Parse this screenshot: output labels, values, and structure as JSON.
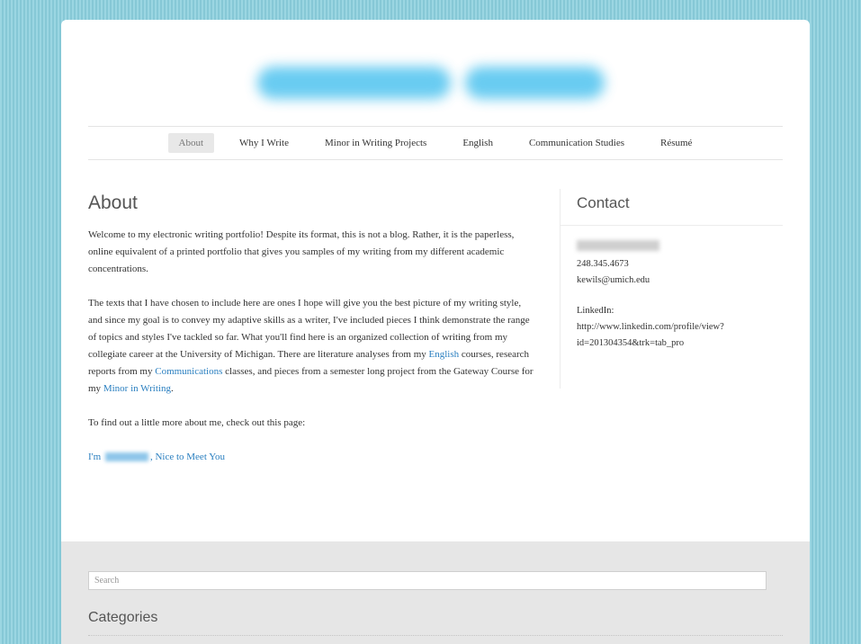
{
  "nav": {
    "items": [
      {
        "label": "About",
        "active": true
      },
      {
        "label": "Why I Write"
      },
      {
        "label": "Minor in Writing Projects"
      },
      {
        "label": "English"
      },
      {
        "label": "Communication Studies"
      },
      {
        "label": "Résumé"
      }
    ]
  },
  "main": {
    "title": "About",
    "p1": "Welcome to my electronic writing portfolio!  Despite its format, this is not a blog.  Rather, it is the paperless, online equivalent of a printed portfolio that gives you samples of my writing from my different academic concentrations.",
    "p2_a": "The texts that I have chosen to include here are ones I hope will give you the best picture of my writing style, and since my goal is to convey my adaptive skills as a writer, I've included pieces I think demonstrate the range of topics and styles I've tackled so far.  What you'll find here is an organized collection of writing from my collegiate career at the University of Michigan.  There are literature analyses from my ",
    "p2_link_english": "English",
    "p2_b": " courses, research reports from my ",
    "p2_link_comm": "Communications",
    "p2_c": " classes, and pieces from a semester long project from the Gateway Course for my ",
    "p2_link_minor": "Minor in Writing",
    "p2_d": ".",
    "p3": "To find out a little more about me, check out this page:",
    "link_prefix": "I'm ",
    "link_suffix": ", Nice to Meet You"
  },
  "sidebar": {
    "title": "Contact",
    "phone": "248.345.4673",
    "email": "kewils@umich.edu",
    "linkedin_label": "LinkedIn:",
    "linkedin_url_1": "http://www.linkedin.com/profile/view?",
    "linkedin_url_2": "id=201304354&trk=tab_pro"
  },
  "footer": {
    "search_placeholder": "Search",
    "categories_title": "Categories"
  },
  "colors": {
    "background": "#8fcfdc",
    "link": "#2a7fc0",
    "footer": "#e6e6e6"
  }
}
